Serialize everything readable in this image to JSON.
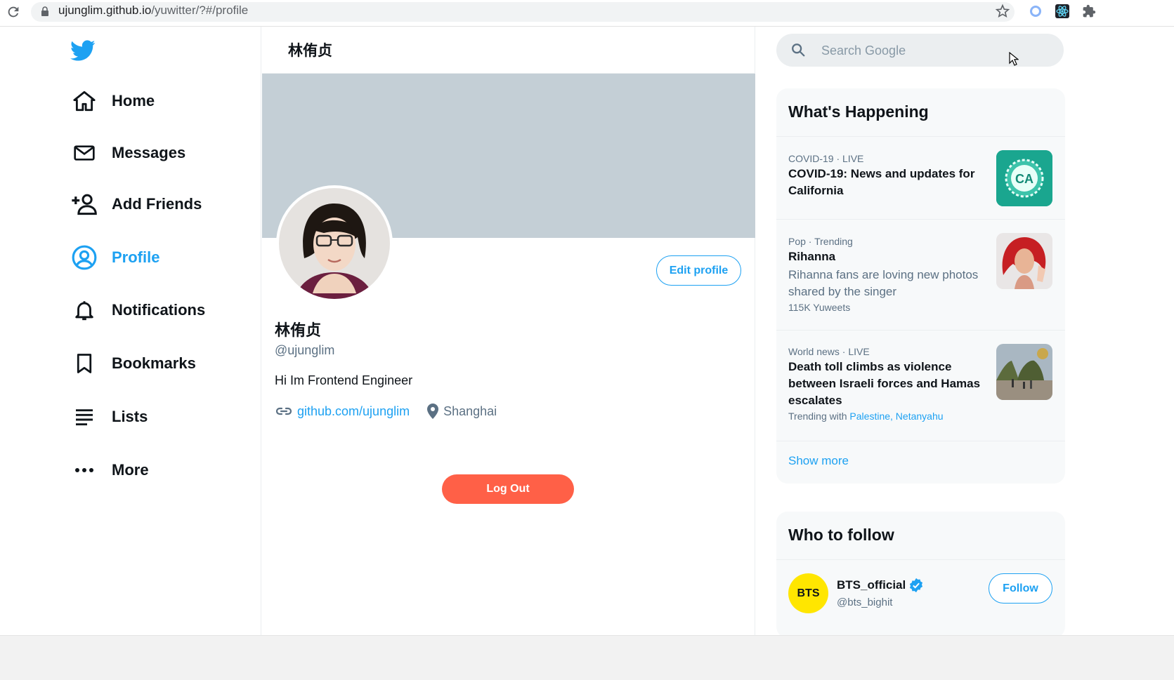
{
  "browser": {
    "url_host": "ujunglim.github.io",
    "url_path": "/yuwitter/?#/profile"
  },
  "nav": {
    "items": [
      {
        "label": "Home",
        "icon": "home-icon"
      },
      {
        "label": "Messages",
        "icon": "mail-icon"
      },
      {
        "label": "Add Friends",
        "icon": "add-user-icon"
      },
      {
        "label": "Profile",
        "icon": "profile-icon",
        "active": true
      },
      {
        "label": "Notifications",
        "icon": "bell-icon"
      },
      {
        "label": "Bookmarks",
        "icon": "bookmark-icon"
      },
      {
        "label": "Lists",
        "icon": "list-icon"
      },
      {
        "label": "More",
        "icon": "more-icon"
      }
    ]
  },
  "profile": {
    "header_title": "林侑贞",
    "name": "林侑贞",
    "handle": "@ujunglim",
    "bio": "Hi Im Frontend Engineer",
    "link": "github.com/ujunglim",
    "location": "Shanghai",
    "edit_label": "Edit profile",
    "logout_label": "Log Out"
  },
  "search": {
    "placeholder": "Search Google"
  },
  "happening": {
    "title": "What's Happening",
    "trends": [
      {
        "meta": "COVID-19 · LIVE",
        "title": "COVID-19: News and updates for California",
        "thumb_text": "CA"
      },
      {
        "meta": "Pop · Trending",
        "title": "Rihanna",
        "desc": "Rihanna fans are loving new photos shared by the singer",
        "sub": "115K Yuweets"
      },
      {
        "meta": "World news · LIVE",
        "title": "Death toll climbs as violence between Israeli forces and Hamas escalates",
        "sub_prefix": "Trending with",
        "sub_link1": "Palestine,",
        "sub_link2": "Netanyahu"
      }
    ],
    "show_more": "Show more"
  },
  "who_to_follow": {
    "title": "Who to follow",
    "user": {
      "avatar_text": "BTS",
      "name": "BTS_official",
      "handle": "@bts_bighit",
      "button": "Follow"
    }
  },
  "colors": {
    "accent": "#1da1f2",
    "logout": "#ff6047",
    "banner": "#c4cfd6"
  }
}
